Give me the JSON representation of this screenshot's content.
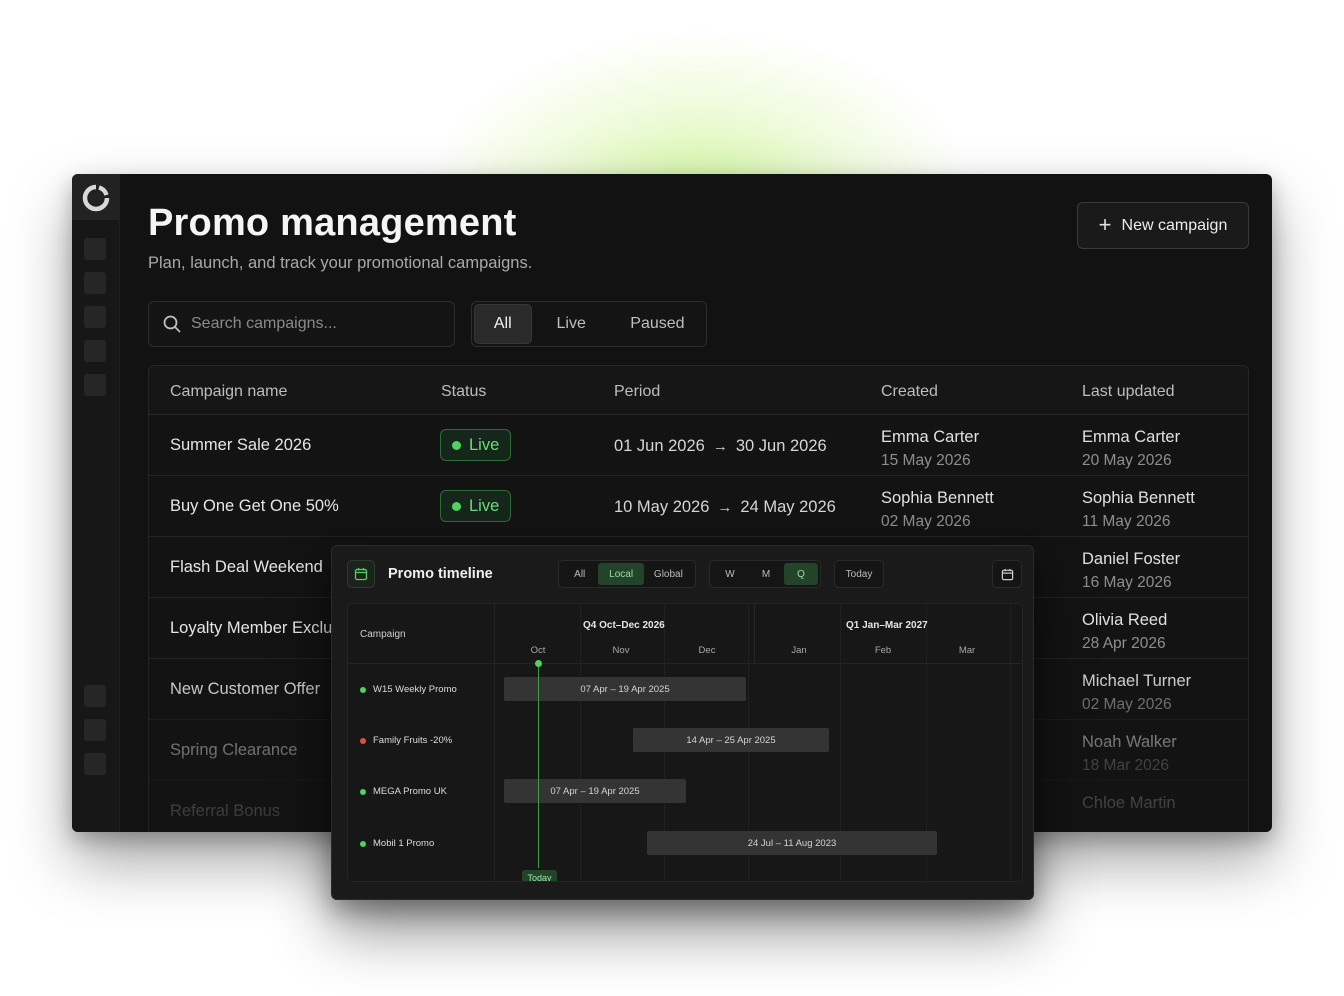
{
  "header": {
    "title": "Promo management",
    "subtitle": "Plan, launch, and track your promotional campaigns.",
    "new_campaign_label": "New campaign"
  },
  "search": {
    "placeholder": "Search campaigns..."
  },
  "filters": {
    "all": "All",
    "live": "Live",
    "paused": "Paused",
    "selected": "All"
  },
  "table": {
    "columns": [
      "Campaign name",
      "Status",
      "Period",
      "Created",
      "Last updated"
    ],
    "rows": [
      {
        "name": "Summer Sale 2026",
        "status": "Live",
        "start": "01 Jun 2026",
        "end": "30 Jun 2026",
        "created_by": "Emma Carter",
        "created_on": "15 May 2026",
        "updated_by": "Emma Carter",
        "updated_on": "20 May 2026"
      },
      {
        "name": "Buy One Get One 50%",
        "status": "Live",
        "start": "10 May 2026",
        "end": "24 May 2026",
        "created_by": "Sophia Bennett",
        "created_on": "02 May 2026",
        "updated_by": "Sophia Bennett",
        "updated_on": "11 May 2026"
      },
      {
        "name": "Flash Deal Weekend",
        "updated_by": "Daniel Foster",
        "updated_on": "16 May 2026"
      },
      {
        "name": "Loyalty Member Exclus",
        "updated_by": "Olivia Reed",
        "updated_on": "28 Apr 2026"
      },
      {
        "name": "New Customer Offer",
        "updated_by": "Michael Turner",
        "updated_on": "02 May 2026"
      },
      {
        "name": "Spring Clearance",
        "updated_by": "Noah Walker",
        "updated_on": "18 Mar 2026"
      },
      {
        "name": "Referral Bonus",
        "updated_by": "Chloe Martin",
        "updated_on": ""
      }
    ]
  },
  "timeline": {
    "title": "Promo timeline",
    "scope": {
      "all": "All",
      "local": "Local",
      "global": "Global",
      "selected": "Local"
    },
    "zoom": {
      "w": "W",
      "m": "M",
      "q": "Q",
      "selected": "Q"
    },
    "today_label": "Today",
    "campaign_header": "Campaign",
    "quarters": [
      "Q4 Oct–Dec 2026",
      "Q1 Jan–Mar 2027"
    ],
    "months": [
      "Oct",
      "Nov",
      "Dec",
      "Jan",
      "Feb",
      "Mar"
    ],
    "items": [
      {
        "name": "W15 Weekly Promo",
        "status_color": "#4fd35e",
        "range": "07 Apr – 19 Apr 2025"
      },
      {
        "name": "Family Fruits -20%",
        "status_color": "#e0503f",
        "range": "14 Apr – 25 Apr 2025"
      },
      {
        "name": "MEGA Promo UK",
        "status_color": "#4fd35e",
        "range": "07 Apr – 19 Apr 2025"
      },
      {
        "name": "Mobil 1 Promo",
        "status_color": "#4fd35e",
        "range": "24 Jul – 11 Aug 2023"
      }
    ],
    "today_marker": "Today"
  },
  "icons": {
    "logo": "logo-ring-icon",
    "search": "search-icon",
    "plus": "plus-icon",
    "calendar": "calendar-icon"
  },
  "colors": {
    "accent": "#4fd35e",
    "danger": "#e0503f",
    "background": "#121212"
  }
}
